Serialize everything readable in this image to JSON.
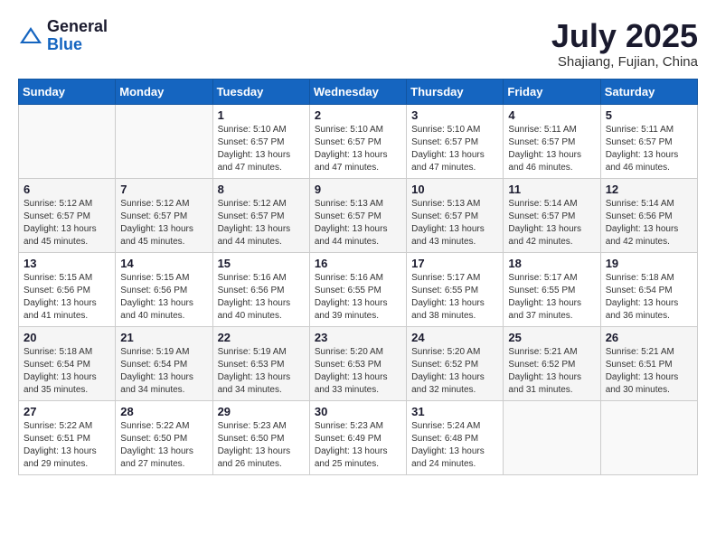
{
  "header": {
    "logo_general": "General",
    "logo_blue": "Blue",
    "month_title": "July 2025",
    "location": "Shajiang, Fujian, China"
  },
  "weekdays": [
    "Sunday",
    "Monday",
    "Tuesday",
    "Wednesday",
    "Thursday",
    "Friday",
    "Saturday"
  ],
  "weeks": [
    [
      {
        "day": "",
        "info": ""
      },
      {
        "day": "",
        "info": ""
      },
      {
        "day": "1",
        "info": "Sunrise: 5:10 AM\nSunset: 6:57 PM\nDaylight: 13 hours and 47 minutes."
      },
      {
        "day": "2",
        "info": "Sunrise: 5:10 AM\nSunset: 6:57 PM\nDaylight: 13 hours and 47 minutes."
      },
      {
        "day": "3",
        "info": "Sunrise: 5:10 AM\nSunset: 6:57 PM\nDaylight: 13 hours and 47 minutes."
      },
      {
        "day": "4",
        "info": "Sunrise: 5:11 AM\nSunset: 6:57 PM\nDaylight: 13 hours and 46 minutes."
      },
      {
        "day": "5",
        "info": "Sunrise: 5:11 AM\nSunset: 6:57 PM\nDaylight: 13 hours and 46 minutes."
      }
    ],
    [
      {
        "day": "6",
        "info": "Sunrise: 5:12 AM\nSunset: 6:57 PM\nDaylight: 13 hours and 45 minutes."
      },
      {
        "day": "7",
        "info": "Sunrise: 5:12 AM\nSunset: 6:57 PM\nDaylight: 13 hours and 45 minutes."
      },
      {
        "day": "8",
        "info": "Sunrise: 5:12 AM\nSunset: 6:57 PM\nDaylight: 13 hours and 44 minutes."
      },
      {
        "day": "9",
        "info": "Sunrise: 5:13 AM\nSunset: 6:57 PM\nDaylight: 13 hours and 44 minutes."
      },
      {
        "day": "10",
        "info": "Sunrise: 5:13 AM\nSunset: 6:57 PM\nDaylight: 13 hours and 43 minutes."
      },
      {
        "day": "11",
        "info": "Sunrise: 5:14 AM\nSunset: 6:57 PM\nDaylight: 13 hours and 42 minutes."
      },
      {
        "day": "12",
        "info": "Sunrise: 5:14 AM\nSunset: 6:56 PM\nDaylight: 13 hours and 42 minutes."
      }
    ],
    [
      {
        "day": "13",
        "info": "Sunrise: 5:15 AM\nSunset: 6:56 PM\nDaylight: 13 hours and 41 minutes."
      },
      {
        "day": "14",
        "info": "Sunrise: 5:15 AM\nSunset: 6:56 PM\nDaylight: 13 hours and 40 minutes."
      },
      {
        "day": "15",
        "info": "Sunrise: 5:16 AM\nSunset: 6:56 PM\nDaylight: 13 hours and 40 minutes."
      },
      {
        "day": "16",
        "info": "Sunrise: 5:16 AM\nSunset: 6:55 PM\nDaylight: 13 hours and 39 minutes."
      },
      {
        "day": "17",
        "info": "Sunrise: 5:17 AM\nSunset: 6:55 PM\nDaylight: 13 hours and 38 minutes."
      },
      {
        "day": "18",
        "info": "Sunrise: 5:17 AM\nSunset: 6:55 PM\nDaylight: 13 hours and 37 minutes."
      },
      {
        "day": "19",
        "info": "Sunrise: 5:18 AM\nSunset: 6:54 PM\nDaylight: 13 hours and 36 minutes."
      }
    ],
    [
      {
        "day": "20",
        "info": "Sunrise: 5:18 AM\nSunset: 6:54 PM\nDaylight: 13 hours and 35 minutes."
      },
      {
        "day": "21",
        "info": "Sunrise: 5:19 AM\nSunset: 6:54 PM\nDaylight: 13 hours and 34 minutes."
      },
      {
        "day": "22",
        "info": "Sunrise: 5:19 AM\nSunset: 6:53 PM\nDaylight: 13 hours and 34 minutes."
      },
      {
        "day": "23",
        "info": "Sunrise: 5:20 AM\nSunset: 6:53 PM\nDaylight: 13 hours and 33 minutes."
      },
      {
        "day": "24",
        "info": "Sunrise: 5:20 AM\nSunset: 6:52 PM\nDaylight: 13 hours and 32 minutes."
      },
      {
        "day": "25",
        "info": "Sunrise: 5:21 AM\nSunset: 6:52 PM\nDaylight: 13 hours and 31 minutes."
      },
      {
        "day": "26",
        "info": "Sunrise: 5:21 AM\nSunset: 6:51 PM\nDaylight: 13 hours and 30 minutes."
      }
    ],
    [
      {
        "day": "27",
        "info": "Sunrise: 5:22 AM\nSunset: 6:51 PM\nDaylight: 13 hours and 29 minutes."
      },
      {
        "day": "28",
        "info": "Sunrise: 5:22 AM\nSunset: 6:50 PM\nDaylight: 13 hours and 27 minutes."
      },
      {
        "day": "29",
        "info": "Sunrise: 5:23 AM\nSunset: 6:50 PM\nDaylight: 13 hours and 26 minutes."
      },
      {
        "day": "30",
        "info": "Sunrise: 5:23 AM\nSunset: 6:49 PM\nDaylight: 13 hours and 25 minutes."
      },
      {
        "day": "31",
        "info": "Sunrise: 5:24 AM\nSunset: 6:48 PM\nDaylight: 13 hours and 24 minutes."
      },
      {
        "day": "",
        "info": ""
      },
      {
        "day": "",
        "info": ""
      }
    ]
  ]
}
